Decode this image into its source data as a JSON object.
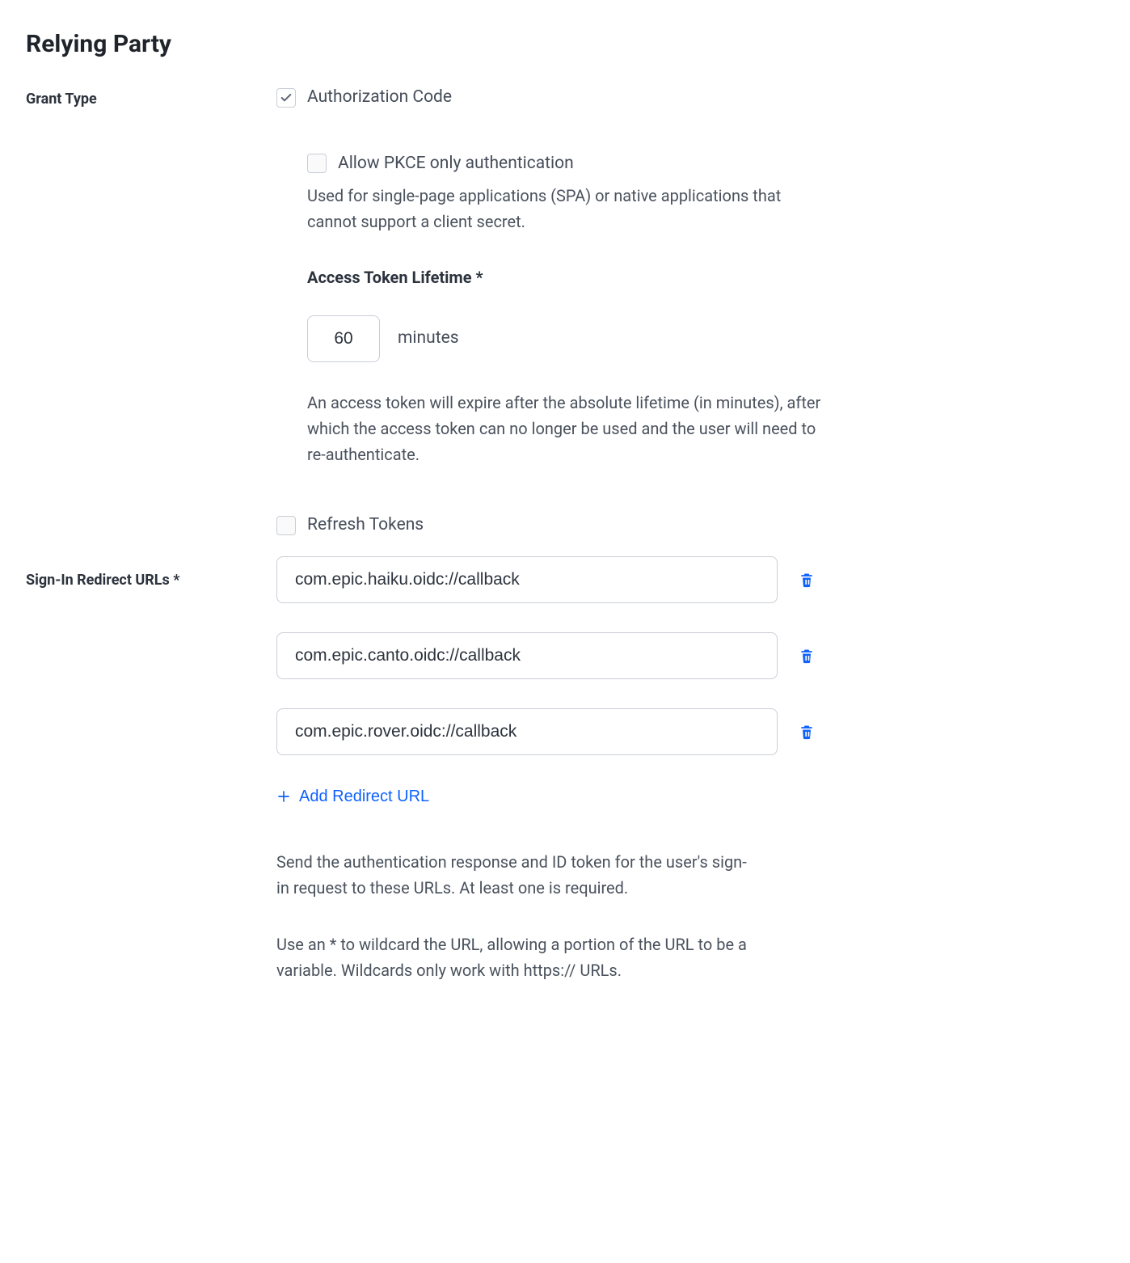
{
  "title": "Relying Party",
  "grant_type": {
    "label": "Grant Type",
    "auth_code": {
      "label": "Authorization Code",
      "checked": true
    },
    "pkce": {
      "label": "Allow PKCE only authentication",
      "checked": false,
      "hint": "Used for single-page applications (SPA) or native applications that cannot support a client secret."
    },
    "lifetime": {
      "label": "Access Token Lifetime *",
      "value": "60",
      "unit": "minutes",
      "hint": "An access token will expire after the absolute lifetime (in minutes), after which the access token can no longer be used and the user will need to re-authenticate."
    },
    "refresh": {
      "label": "Refresh Tokens",
      "checked": false
    }
  },
  "redirect": {
    "label": "Sign-In Redirect URLs *",
    "urls": [
      "com.epic.haiku.oidc://callback",
      "com.epic.canto.oidc://callback",
      "com.epic.rover.oidc://callback"
    ],
    "add_label": "Add Redirect URL",
    "desc1": "Send the authentication response and ID token for the user's sign-in request to these URLs. At least one is required.",
    "desc2": "Use an * to wildcard the URL, allowing a portion of the URL to be a variable. Wildcards only work with https:// URLs."
  }
}
